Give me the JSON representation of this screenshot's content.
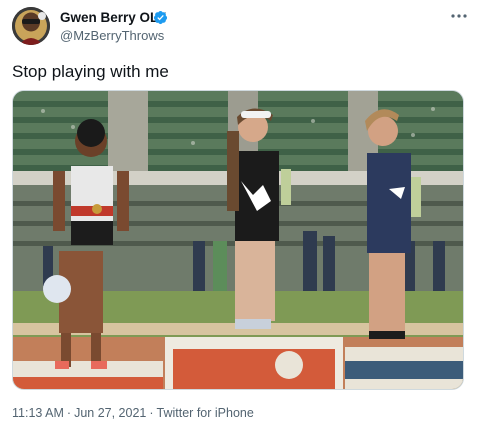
{
  "user": {
    "display_name": "Gwen Berry OLY",
    "handle": "@MzBerryThrows",
    "verified": true
  },
  "tweet": {
    "text": "Stop playing with me"
  },
  "meta": {
    "time": "11:13 AM",
    "separator": "·",
    "date": "Jun 27, 2021",
    "source": "Twitter for iPhone"
  },
  "icons": {
    "verified": "verified-badge-icon",
    "more": "more-dots-icon"
  },
  "colors": {
    "text_primary": "#0f1419",
    "text_secondary": "#536471",
    "verified_blue": "#1d9bf0",
    "border": "#cfd9de"
  }
}
